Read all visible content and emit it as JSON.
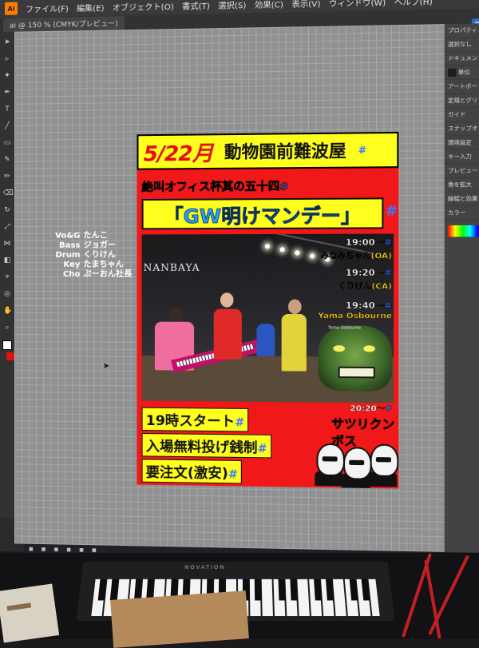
{
  "app": {
    "logo": "Ai",
    "menu": [
      "ファイル(F)",
      "編集(E)",
      "オブジェクト(O)",
      "書式(T)",
      "選択(S)",
      "効果(C)",
      "表示(V)",
      "ウィンドウ(W)",
      "ヘルプ(H)"
    ],
    "doc_tab": "ai @ 150 % (CMYK/プレビュー)",
    "share_label": "共有",
    "panels": [
      "プロパティ",
      "選択なし",
      "ドキュメント",
      "単位",
      "アートボード",
      "定規とグリッド",
      "ガイド",
      "スナップオプション",
      "環境設定",
      "キー入力",
      "プレビュー",
      "角を拡大",
      "線幅と効果",
      "カラー"
    ]
  },
  "pasteboard_note": [
    {
      "role": "Vo&G",
      "name": "たんこ"
    },
    {
      "role": "Bass",
      "name": "ジョガー"
    },
    {
      "role": "Drum",
      "name": "くりけん"
    },
    {
      "role": "Key",
      "name": "たまちゃん"
    },
    {
      "role": "Cho",
      "name": "ぷーおん社長"
    }
  ],
  "poster": {
    "date": "5/22月",
    "venue": "動物園前難波屋",
    "series": "絶叫オフィス杯其の五十四",
    "event_title": "「GW明けマンデー」",
    "photo_sign": "NANBAYA",
    "monster_label": "Yama Osbourne",
    "slots": [
      {
        "time": "19:00～",
        "name": "みなみちゃん(OA)"
      },
      {
        "time": "19:20～",
        "name": "くりけん(CA)"
      },
      {
        "time": "19:40～",
        "name": "Yama Osbourne"
      }
    ],
    "last_time": "20:20～",
    "last_band": "サツリクンボス",
    "bottom_lines": [
      "19時スタート",
      "入場無料投げ銭制",
      "要注文(激安)"
    ],
    "mark": "#"
  },
  "keyboard_brand": "NOVATION"
}
